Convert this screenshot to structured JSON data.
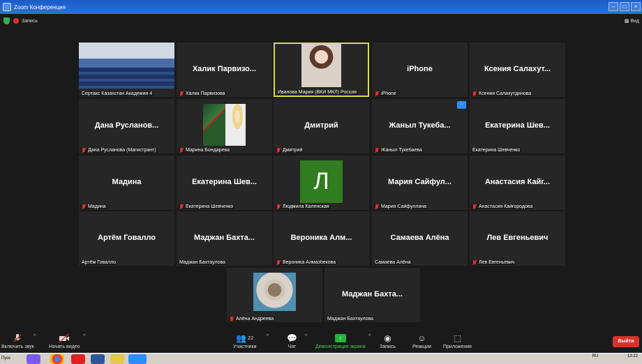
{
  "window": {
    "title": "Zoom Конференция"
  },
  "topbar": {
    "recording_label": "Запись",
    "view_label": "Вид"
  },
  "tiles": [
    {
      "display": "",
      "label": "Сертакс Казахстан Академия 4"
    },
    {
      "display": "Халик Парвизо...",
      "label": "Халик Парвизова"
    },
    {
      "display": "",
      "label": "Иванова Мария (ВКИ МКЛ) Россия"
    },
    {
      "display": "iPhone",
      "label": "iPhone"
    },
    {
      "display": "Ксения Салахут...",
      "label": "Ксения Салахутдинова"
    },
    {
      "display": "Дана Русланов...",
      "label": "Дана Русланова (Магистрант)"
    },
    {
      "display": "",
      "label": "Марина Бондарева"
    },
    {
      "display": "Дмитрий",
      "label": "Дмитрий"
    },
    {
      "display": "Жаныл Тукеба...",
      "label": "Жаныл Тукебаева"
    },
    {
      "display": "Екатерина Шев...",
      "label": "Екатерина Шевченко"
    },
    {
      "display": "Мадина",
      "label": "Мадина"
    },
    {
      "display": "Екатерина Шев...",
      "label": "Екатерина Шевченко"
    },
    {
      "display": "Л",
      "label": "Людмила Каленская"
    },
    {
      "display": "Мария Сайфул...",
      "label": "Мария Сайфуллина"
    },
    {
      "display": "Анастасия Кайг...",
      "label": "Анастасия Кайгородова"
    },
    {
      "display": "Артём Говалло",
      "label": "Артём Говалло"
    },
    {
      "display": "Маджан Бахта...",
      "label": "Маджан Бахтаулова"
    },
    {
      "display": "Вероника Алм...",
      "label": "Вероника Алмазбекова"
    },
    {
      "display": "Самаева Алёна",
      "label": "Самаева Алёна"
    },
    {
      "display": "Лев Евгеньевич",
      "label": "Лев Евгеньевич"
    },
    {
      "display": "",
      "label": "Алёна Андреева"
    },
    {
      "display": "Маджан Бахта...",
      "label": "Маджан Бахтаулова"
    }
  ],
  "toolbar": {
    "unmute": "Включить звук",
    "start_video": "Начать видео",
    "participants": "Участники",
    "participants_count": "22",
    "chat": "Чат",
    "share": "Демонстрация экрана",
    "record": "Запись",
    "reactions": "Реакции",
    "apps": "Приложения",
    "leave": "Выйти"
  },
  "taskbar": {
    "start": "Пуск",
    "lang": "RU",
    "time": "13:22"
  }
}
